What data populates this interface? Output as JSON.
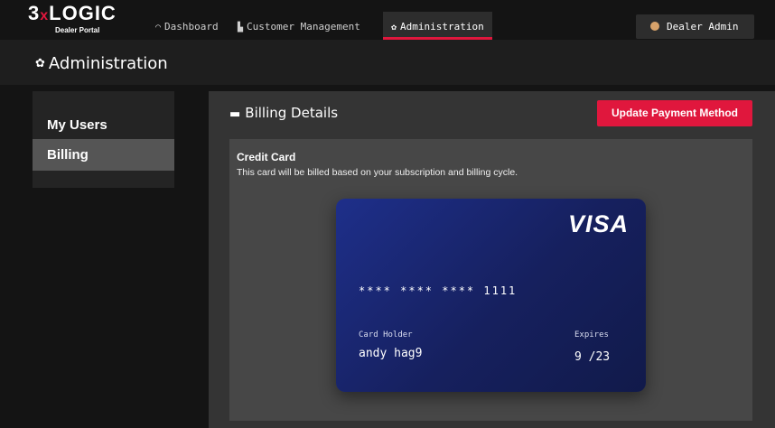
{
  "brand": {
    "logo_pre": "3",
    "logo_x": "x",
    "logo_main": "LOGIC",
    "subtitle": "Dealer Portal"
  },
  "nav": {
    "items": [
      {
        "label": "Dashboard",
        "icon": "dashboard-icon"
      },
      {
        "label": "Customer Management",
        "icon": "building-icon"
      },
      {
        "label": "Administration",
        "icon": "gear-icon",
        "active": true
      }
    ],
    "user_label": "Dealer Admin"
  },
  "page": {
    "title": "Administration"
  },
  "sidebar": {
    "items": [
      {
        "label": "My Users"
      },
      {
        "label": "Billing",
        "active": true
      }
    ]
  },
  "billing": {
    "title": "Billing Details",
    "update_button": "Update Payment Method",
    "card_section_title": "Credit Card",
    "card_section_desc": "This card will be billed based on your subscription and billing cycle."
  },
  "card": {
    "brand": "VISA",
    "number": "**** **** **** 1111",
    "holder_label": "Card Holder",
    "holder": "andy hag9",
    "expires_label": "Expires",
    "expires": "9 /23"
  },
  "colors": {
    "accent": "#e0173d",
    "card_blue": "#16205e",
    "panel": "#343434"
  }
}
